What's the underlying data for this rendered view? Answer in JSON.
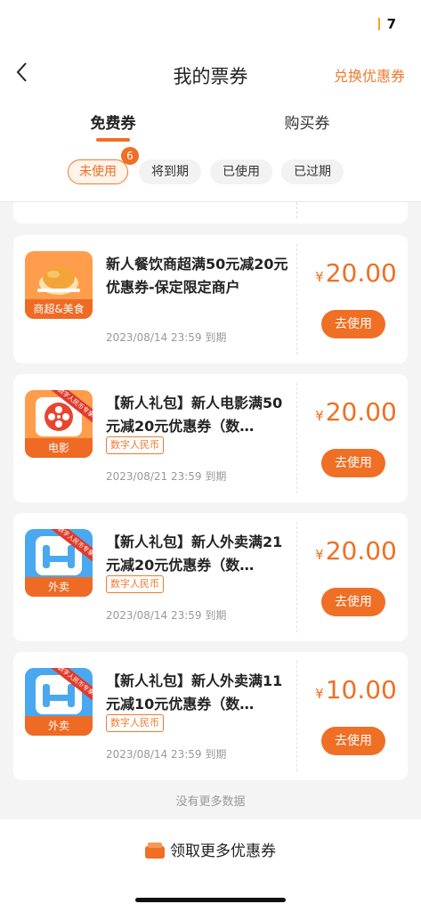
{
  "status": {
    "time": "7"
  },
  "header": {
    "title": "我的票券",
    "exchange_label": "兑换优惠券"
  },
  "tabs": [
    {
      "label": "免费券",
      "active": true
    },
    {
      "label": "购买券",
      "active": false
    }
  ],
  "filters": [
    {
      "label": "未使用",
      "active": true,
      "badge": "6"
    },
    {
      "label": "将到期",
      "active": false
    },
    {
      "label": "已使用",
      "active": false
    },
    {
      "label": "已过期",
      "active": false
    }
  ],
  "coupons": [
    {
      "icon": "roast-chicken-icon",
      "icon_label": "商超&美食",
      "title": "新人餐饮商超满50元减20元优惠券-保定限定商户",
      "tag": "",
      "expiry": "2023/08/14 23:59 到期",
      "currency": "¥",
      "amount": "20.00",
      "action": "去使用"
    },
    {
      "icon": "film-reel-icon",
      "icon_label": "电影",
      "ribbon": "数字人民币专享",
      "title": "【新人礼包】新人电影满50元减20元优惠券（数…",
      "tag": "数字人民币",
      "expiry": "2023/08/21 23:59 到期",
      "currency": "¥",
      "amount": "20.00",
      "action": "去使用"
    },
    {
      "icon": "delivery-icon",
      "icon_label": "外卖",
      "ribbon": "数字人民币专享",
      "title": "【新人礼包】新人外卖满21元减20元优惠券（数…",
      "tag": "数字人民币",
      "expiry": "2023/08/14 23:59 到期",
      "currency": "¥",
      "amount": "20.00",
      "action": "去使用"
    },
    {
      "icon": "delivery-icon",
      "icon_label": "外卖",
      "ribbon": "数字人民币专享",
      "title": "【新人礼包】新人外卖满11元减10元优惠券（数…",
      "tag": "数字人民币",
      "expiry": "2023/08/14 23:59 到期",
      "currency": "¥",
      "amount": "10.00",
      "action": "去使用"
    }
  ],
  "footer": {
    "no_more": "没有更多数据",
    "more_label": "领取更多优惠券"
  },
  "colors": {
    "accent": "#ef6f24",
    "background": "#f4f4f4"
  }
}
